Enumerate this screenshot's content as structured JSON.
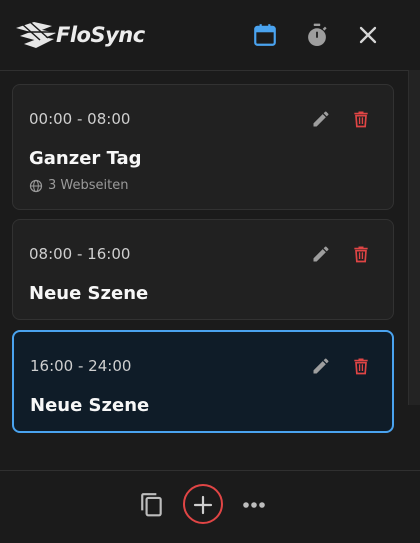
{
  "app": {
    "name": "FloSync"
  },
  "header": {
    "icons": [
      "calendar-icon",
      "timer-icon",
      "close-icon"
    ],
    "accent": "#4aa3ef"
  },
  "scenes": [
    {
      "time": "00:00 - 08:00",
      "title": "Ganzer Tag",
      "meta": "3 Webseiten",
      "active": false
    },
    {
      "time": "08:00 - 16:00",
      "title": "Neue Szene",
      "active": false
    },
    {
      "time": "16:00 - 24:00",
      "title": "Neue Szene",
      "active": true
    }
  ],
  "colors": {
    "delete": "#e04545",
    "edit": "#9e9e9e",
    "active_border": "#4aa3ef"
  },
  "footer": {
    "icons": [
      "copy-icon",
      "add-icon",
      "more-icon"
    ]
  }
}
